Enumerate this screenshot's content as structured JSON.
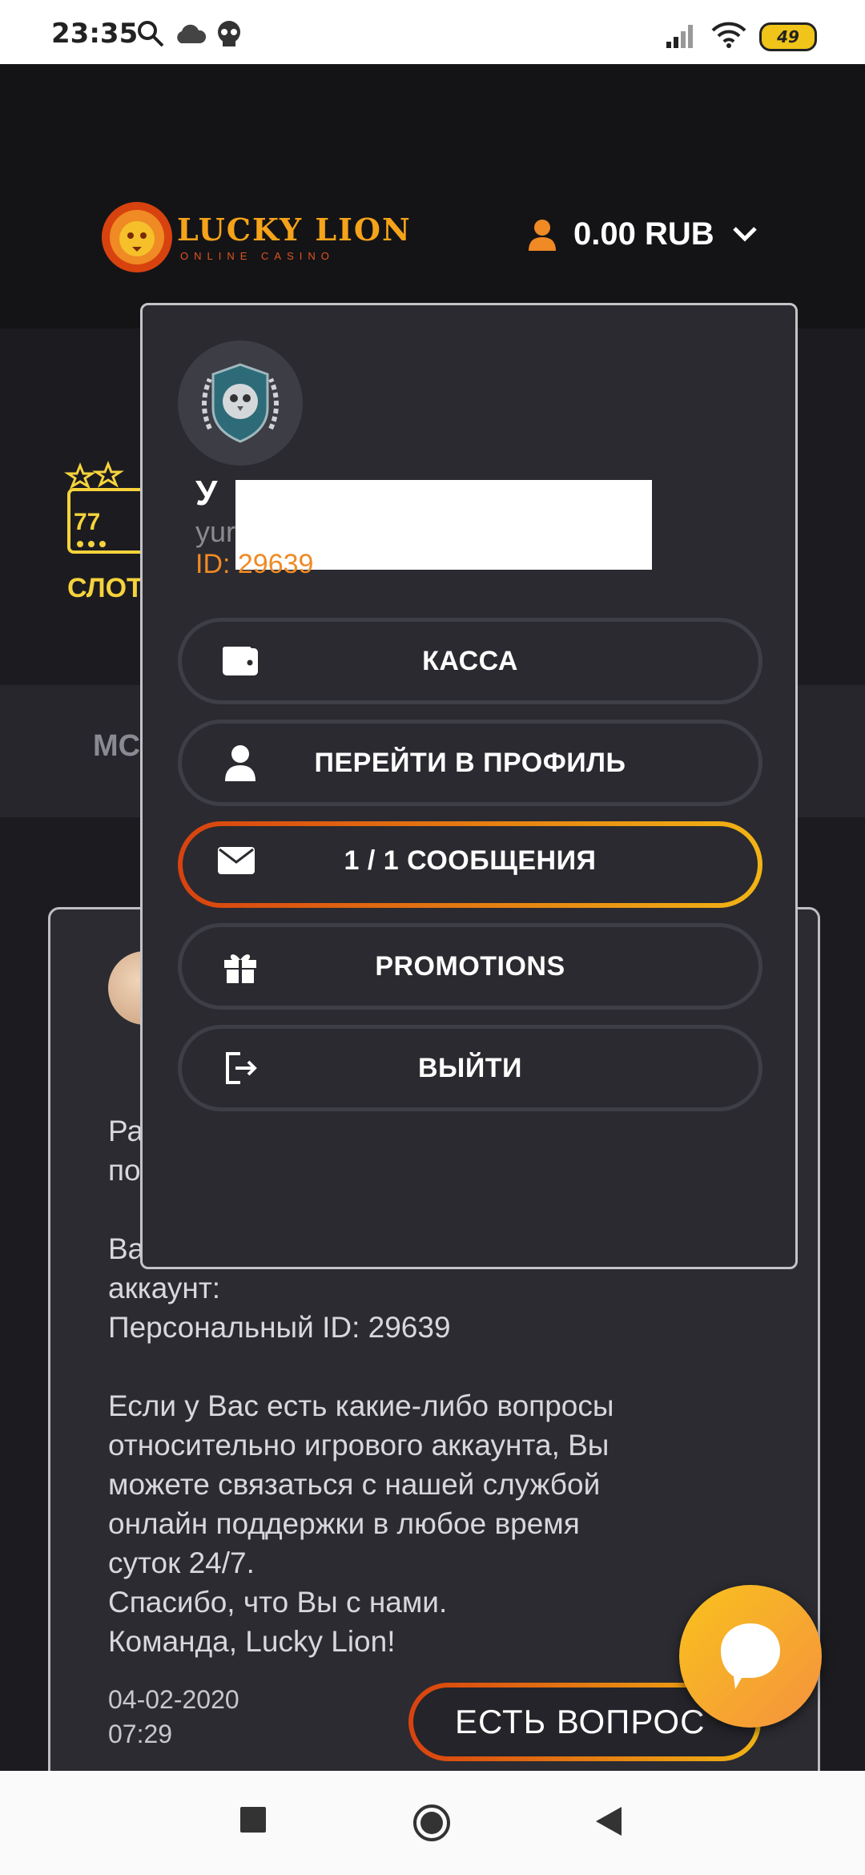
{
  "status_bar": {
    "time": "23:35",
    "battery": "49"
  },
  "header": {
    "logo_brand": "LUCKY LION",
    "logo_tagline": "ONLINE CASINO",
    "balance": "0.00 RUB"
  },
  "background": {
    "slots_label": "СЛОТ",
    "tab_label": "МС"
  },
  "message": {
    "body": "Ра\nпо\n\nВа\nаккаунт:\nПерсональный ID: 29639\n\nЕсли у Вас есть какие-либо вопросы\nотносительно игрового аккаунта, Вы\nможете связаться с нашей службой\nонлайн поддержки в любое время\nсуток 24/7.\nСпасибо, что Вы с нами.\nКоманда, Lucky Lion!",
    "date": "04-02-2020\n07:29",
    "ask_button": "ЕСТЬ ВОПРОС"
  },
  "dropdown": {
    "username": "У",
    "login": "yur",
    "user_id": "ID: 29639",
    "menu": [
      {
        "label": "КАССА",
        "icon": "wallet-icon",
        "active": false
      },
      {
        "label": "ПЕРЕЙТИ В ПРОФИЛЬ",
        "icon": "user-icon",
        "active": false
      },
      {
        "label": "1 / 1 СООБЩЕНИЯ",
        "icon": "envelope-icon",
        "active": true
      },
      {
        "label": "PROMOTIONS",
        "icon": "gift-icon",
        "active": false
      },
      {
        "label": "ВЫЙТИ",
        "icon": "logout-icon",
        "active": false
      }
    ]
  },
  "colors": {
    "accent_orange": "#f08a24",
    "gradient_start": "#d8420f",
    "gradient_end": "#f1b415",
    "slots_yellow": "#f6d33c"
  }
}
